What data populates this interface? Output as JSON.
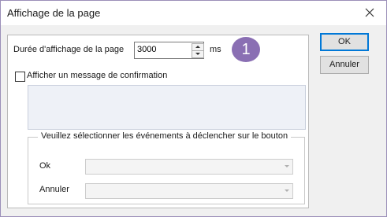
{
  "window": {
    "title": "Affichage de la page"
  },
  "duration": {
    "label": "Durée d'affichage de la page",
    "value": "3000",
    "unit": "ms"
  },
  "badge": {
    "text": "1",
    "color": "#8a6fb3"
  },
  "confirmation": {
    "label": "Afficher un message de confirmation",
    "checked": false,
    "message": ""
  },
  "events": {
    "legend": "Veuillez sélectionner les événements à déclencher sur le bouton",
    "ok_label": "Ok",
    "ok_value": "",
    "cancel_label": "Annuler",
    "cancel_value": ""
  },
  "buttons": {
    "ok": "OK",
    "cancel": "Annuler"
  },
  "icons": {
    "close": "close-icon",
    "spin_up": "arrow-up-icon",
    "spin_down": "arrow-down-icon",
    "dropdown": "chevron-down-icon"
  }
}
